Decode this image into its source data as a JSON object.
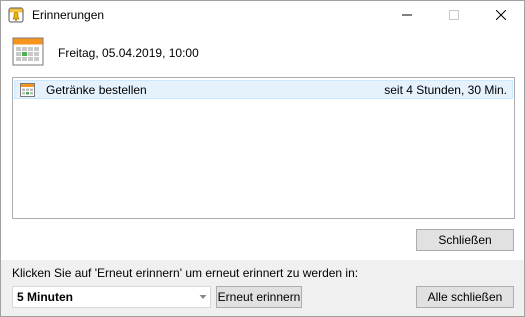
{
  "window": {
    "title": "Erinnerungen",
    "icon": "reminder-bell-icon"
  },
  "header": {
    "icon": "calendar-icon",
    "date": "Freitag, 05.04.2019, 10:00"
  },
  "reminders": [
    {
      "icon": "calendar-item-icon",
      "title": "Getränke bestellen",
      "due": "seit 4 Stunden, 30 Min."
    }
  ],
  "buttons": {
    "close": "Schließen",
    "snooze": "Erneut erinnern",
    "dismiss_all": "Alle schließen"
  },
  "snooze": {
    "label": "Klicken Sie auf 'Erneut erinnern' um erneut erinnert zu werden in:",
    "selected": "5 Minuten"
  },
  "colors": {
    "selection_bg": "#e5f1fb",
    "footer_bg": "#f0f0f0",
    "button_bg": "#e1e1e1"
  }
}
